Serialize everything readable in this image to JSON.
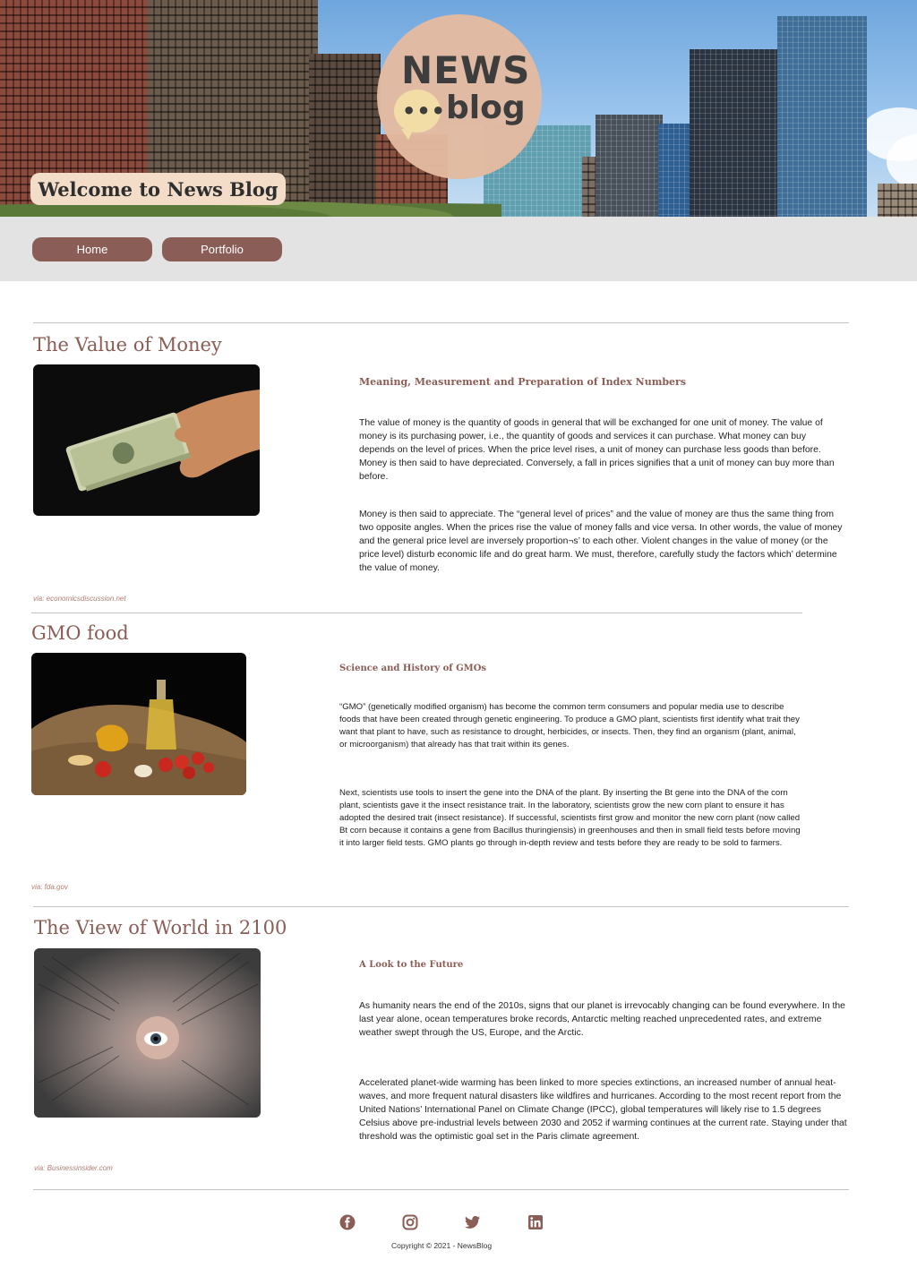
{
  "header": {
    "logo_news": "NEWS",
    "logo_dots": "•••",
    "logo_blog": "blog",
    "welcome": "Welcome to News Blog"
  },
  "nav": {
    "items": [
      {
        "label": "Home"
      },
      {
        "label": "Portfolio"
      }
    ]
  },
  "articles": [
    {
      "title": "The Value of Money",
      "subtitle": "Meaning, Measurement and Preparation of Index Numbers",
      "paragraphs": [
        "The value of money is the quantity of goods in general that will be exchanged for one unit of money. The value of money is its purchasing power, i.e., the quantity of goods and services it can purchase. What money can buy depends on the level of prices. When the price level rises, a unit of money can purchase less goods than before. Money is then said to have depreciated. Conversely, a fall in prices signifies that a unit of money can buy more than before.",
        "Money is then said to appreciate. The “general level of prices” and the value of money are thus the same thing from two opposite angles. When the prices rise the value of money falls and vice versa. In other words, the value of money and the general price level are inversely proportion¬s’ to each other. Violent changes in the value of money (or the price level) disturb economic life and do great harm. We must, therefore, carefully study the factors which’ determine the value of money."
      ],
      "via": "via: economicsdiscussion.net"
    },
    {
      "title": "GMO food",
      "subtitle": "Science and History of GMOs",
      "paragraphs": [
        "“GMO” (genetically modified organism) has become the common term consumers and popular media use to describe foods that have been created through genetic engineering. To produce a GMO plant, scientists first identify what trait they want that plant to have, such as resistance to drought, herbicides, or insects. Then, they find an organism (plant, animal, or microorganism) that already has that trait within its genes.",
        "Next, scientists use tools to insert the gene into the DNA of the plant. By inserting the Bt gene into the DNA of the corn plant, scientists gave it the insect resistance trait. In the laboratory, scientists grow the new corn plant to ensure it has adopted the desired trait (insect resistance). If successful, scientists first grow and monitor the new corn plant (now called Bt corn because it contains a gene from Bacillus thuringiensis) in greenhouses and then in small field tests before moving it into larger field tests. GMO plants go through in-depth review and tests before they are ready to be sold to farmers."
      ],
      "via": "via: fda.gov"
    },
    {
      "title": "The View of World in 2100",
      "subtitle": "A Look to the Future",
      "paragraphs": [
        "As humanity nears the end of the 2010s, signs that our planet is irrevocably changing can be found everywhere. In the last year alone, ocean temperatures broke records, Antarctic melting reached unprecedented rates, and extreme weather swept through the US, Europe, and the Arctic.",
        "Accelerated planet-wide warming has been linked to more species extinctions, an increased number of annual heat-waves, and more frequent natural disasters like wildfires and hurricanes. According to the most recent report from the United Nations’ International Panel on Climate Change (IPCC), global temperatures will likely rise to 1.5 degrees Celsius above pre-industrial levels between 2030 and 2052 if warming continues at the current rate. Staying under that threshold was the optimistic goal set in the Paris climate agreement."
      ],
      "via": "via: Businessinsider.com"
    }
  ],
  "footer": {
    "social": [
      "facebook-icon",
      "instagram-icon",
      "twitter-icon",
      "linkedin-icon"
    ],
    "copyright": "Copyright © 2021 - NewsBlog"
  },
  "colors": {
    "accent": "#8a5d56",
    "nav_bg": "#e3e3e3",
    "logo_circle": "#e3baa0"
  }
}
